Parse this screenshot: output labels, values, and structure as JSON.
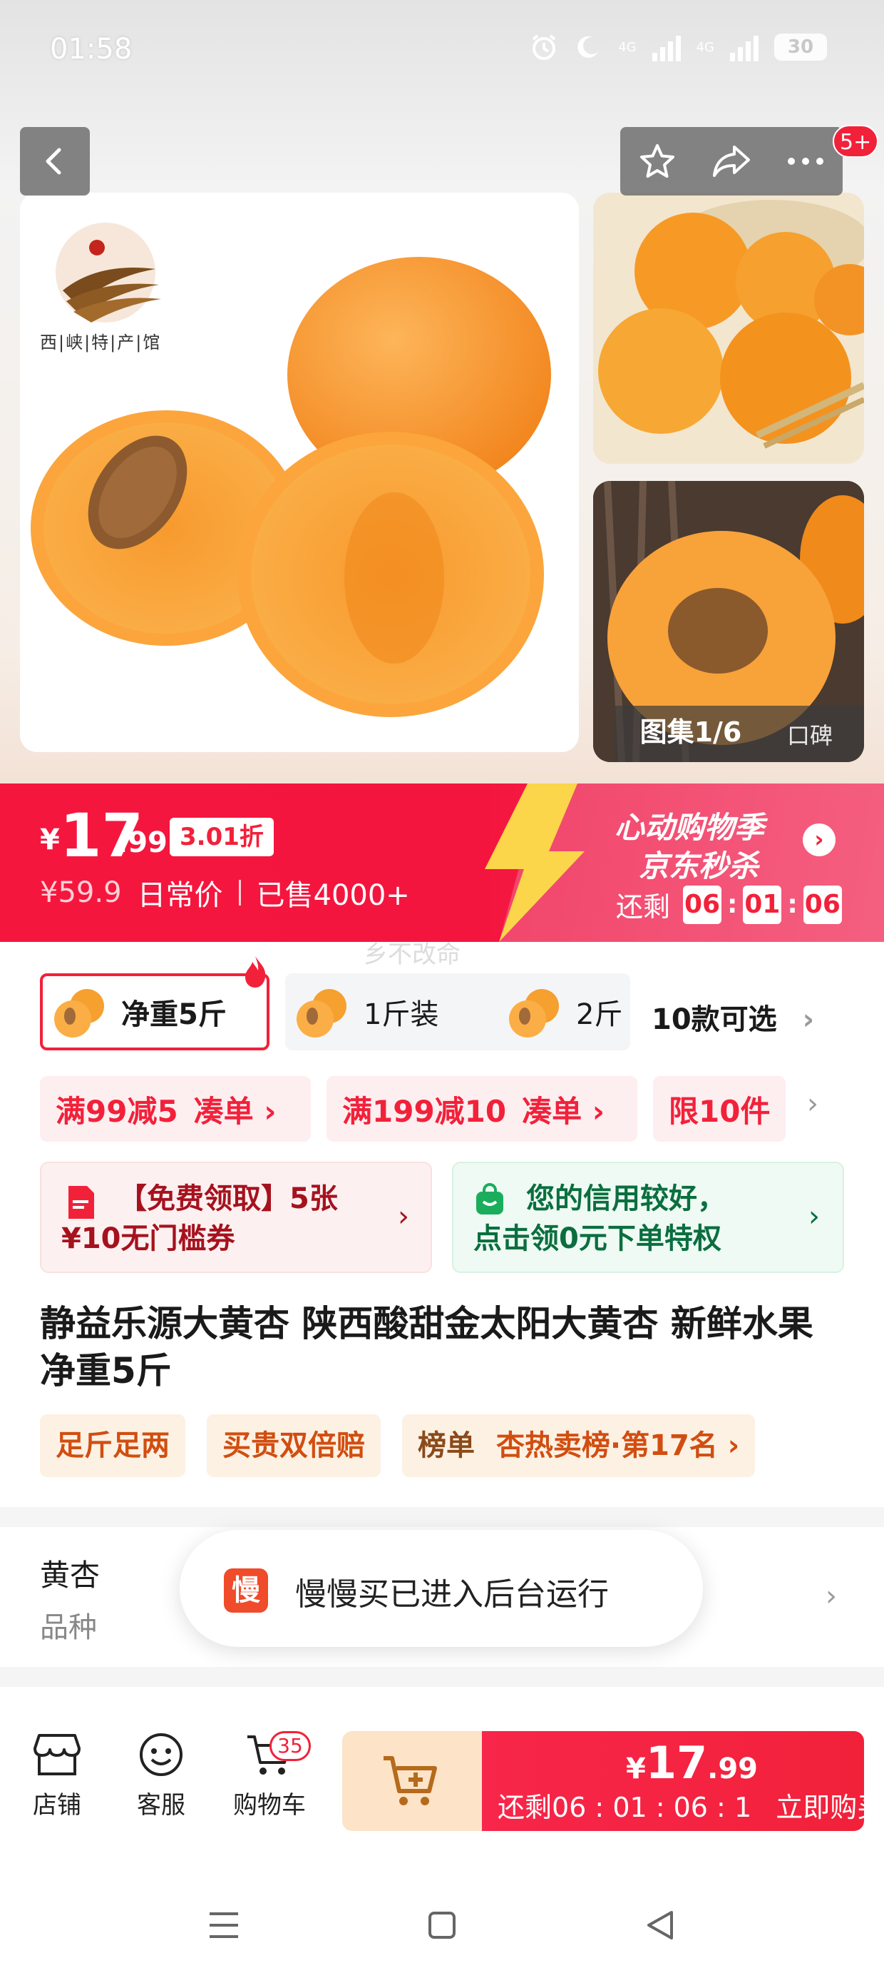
{
  "status_bar": {
    "time": "01:58",
    "network_1": "4G",
    "network_2": "4G",
    "battery": "30"
  },
  "header": {
    "message_badge": "5+"
  },
  "gallery": {
    "shop_logo_text": "西|峡|特|产|馆",
    "counter": "图集1/6",
    "watermark": "口碑"
  },
  "price": {
    "currency": "¥",
    "integer": "17",
    "decimal": ".99",
    "discount": "3.01折",
    "original_price": "¥59.9",
    "original_label": "日常价",
    "sold": "已售4000+"
  },
  "promo": {
    "title": "心动购物季",
    "subtitle": "京东秒杀",
    "remaining_label": "还剩",
    "countdown": [
      "06",
      "01",
      "06"
    ],
    "arrow": "›"
  },
  "ghost_text": "乡不改命",
  "variants": {
    "items": [
      {
        "label": "净重5斤",
        "selected": true
      },
      {
        "label": "1斤装",
        "selected": false
      },
      {
        "label": "2斤",
        "selected": false
      }
    ],
    "more": "10款可选",
    "more_chevron": "›"
  },
  "coupons": [
    {
      "amount": "满99减5",
      "action": "凑单 ›"
    },
    {
      "amount": "满199减10",
      "action": "凑单 ›"
    },
    {
      "amount": "限10件",
      "action": ""
    }
  ],
  "coupon_chevron": "›",
  "cards": {
    "free": {
      "line1": "【免费领取】5张",
      "line2": "¥10无门槛券"
    },
    "credit": {
      "line1": "您的信用较好，",
      "line2": "点击领0元下单特权"
    }
  },
  "product_title": "静益乐源大黄杏 陕西酸甜金太阳大黄杏 新鲜水果 净重5斤",
  "tags": {
    "t1": "足斤足两",
    "t2": "买贵双倍赔",
    "t3_prefix": "榜单",
    "t3": "杏热卖榜·第17名 ›"
  },
  "specs": {
    "value": "黄杏",
    "key": "品种"
  },
  "toast": {
    "icon_text": "慢",
    "text": "慢慢买已进入后台运行"
  },
  "bottom_bar": {
    "shop": "店铺",
    "service": "客服",
    "cart": "购物车",
    "cart_count": "35",
    "buy_currency": "¥",
    "buy_integer": "17",
    "buy_decimal": ".99",
    "buy_sub": "还剩06 : 01 : 06 : 1",
    "buy_label": "立即购买"
  },
  "colors": {
    "accent": "#f2213a",
    "promo_pink": "#f45f80",
    "tag_orange": "#d14e10",
    "credit_green": "#0b6e3f"
  }
}
